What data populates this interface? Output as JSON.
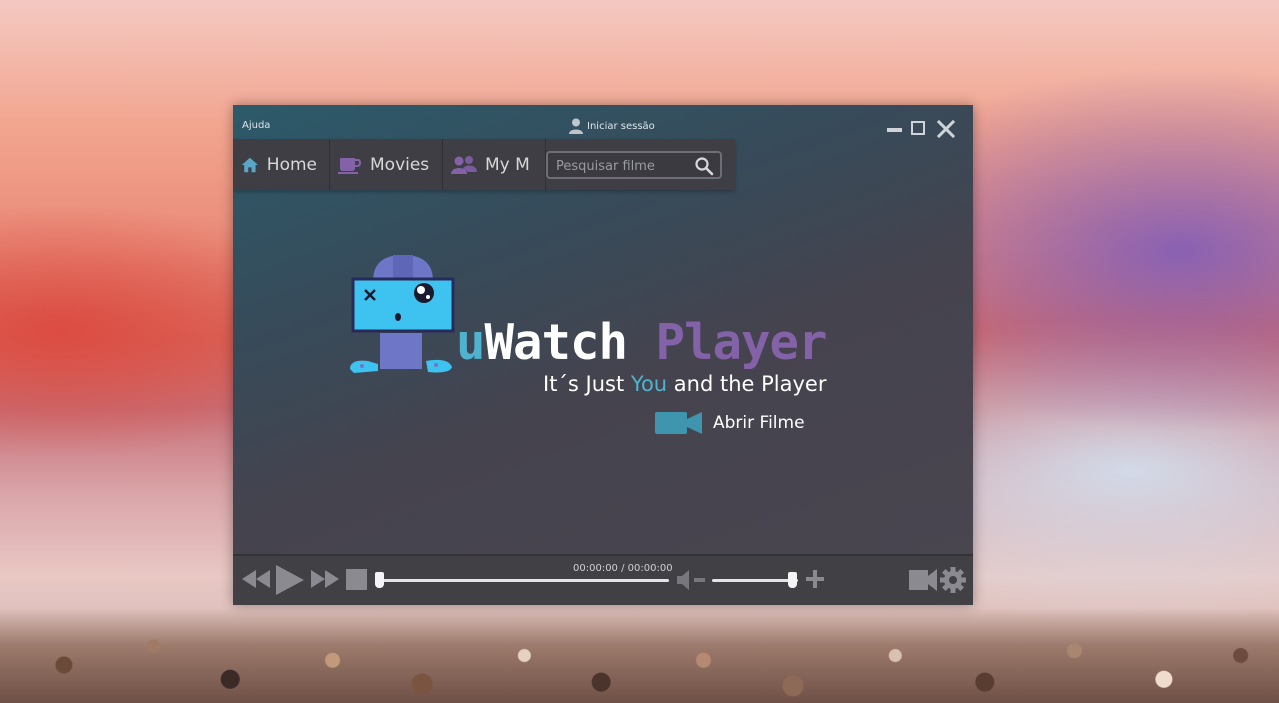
{
  "titlebar": {
    "help_label": "Ajuda",
    "login_label": "Iniciar sessão",
    "icons": {
      "login": "user-icon",
      "minimize": "minimize-icon",
      "maximize": "maximize-icon",
      "close": "close-icon"
    }
  },
  "nav": {
    "items": [
      {
        "label": "Home",
        "icon": "home-icon"
      },
      {
        "label": "Movies",
        "icon": "cup-icon"
      },
      {
        "label": "My M",
        "icon": "users-icon"
      }
    ],
    "search": {
      "placeholder": "Pesquisar filme",
      "value": "",
      "icon": "search-icon"
    }
  },
  "branding": {
    "u": "u",
    "watch": "Watch",
    "player": "Player",
    "tagline_pre": "It´s Just ",
    "tagline_you": "You",
    "tagline_post": " and the Player"
  },
  "open_movie": {
    "label": "Abrir Filme",
    "icon": "video-camera-icon"
  },
  "playback": {
    "time": "00:00:00 / 00:00:00",
    "seek_progress": 0.0,
    "volume_level": 0.94,
    "icons": [
      "rewind-icon",
      "play-icon",
      "fast-forward-icon",
      "stop-icon",
      "mute-icon",
      "volume-up-icon",
      "video-camera-icon",
      "settings-gear-icon"
    ]
  },
  "colors": {
    "accent_blue": "#4fb3cf",
    "accent_purple": "#8362a8",
    "panel": "#404045"
  }
}
